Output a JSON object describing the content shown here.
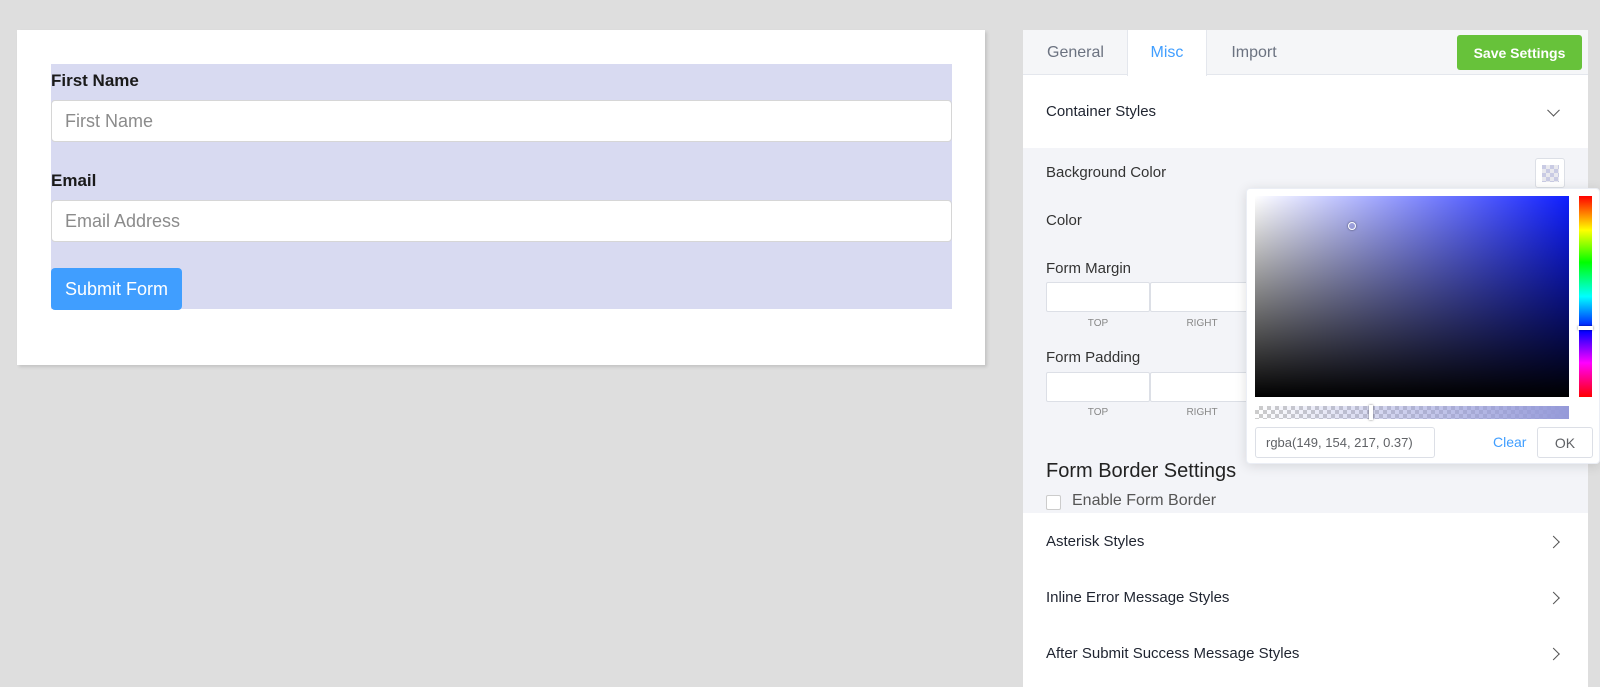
{
  "form": {
    "first_name_label": "First Name",
    "first_name_placeholder": "First Name",
    "email_label": "Email",
    "email_placeholder": "Email Address",
    "submit_label": "Submit Form",
    "background_color": "rgba(149, 154, 217, 0.37)"
  },
  "panel": {
    "tabs": [
      {
        "label": "General",
        "active": false
      },
      {
        "label": "Misc",
        "active": true
      },
      {
        "label": "Import",
        "active": false
      }
    ],
    "save_label": "Save Settings",
    "container_styles": {
      "title": "Container Styles",
      "background_color_label": "Background Color",
      "color_label": "Color",
      "form_margin_label": "Form Margin",
      "form_padding_label": "Form Padding",
      "sides": [
        "TOP",
        "RIGHT"
      ],
      "border_title": "Form Border Settings",
      "enable_border_label": "Enable Form Border"
    },
    "sections": [
      {
        "title": "Asterisk Styles"
      },
      {
        "title": "Inline Error Message Styles"
      },
      {
        "title": "After Submit Success Message Styles"
      }
    ]
  },
  "color_picker": {
    "value": "rgba(149, 154, 217, 0.37)",
    "clear_label": "Clear",
    "ok_label": "OK",
    "hue_color": "#0f1eff",
    "alpha": 0.37
  },
  "colors": {
    "accent": "#409eff",
    "save_button": "#67c23a"
  }
}
